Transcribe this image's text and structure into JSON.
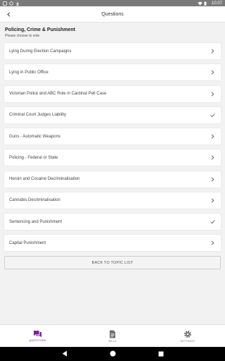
{
  "status_bar": {
    "time": "10:07"
  },
  "header": {
    "title": "Questions"
  },
  "section": {
    "title": "Policing, Crime & Punishment",
    "subtitle": "Please choose to vote"
  },
  "questions": [
    {
      "label": "Lying During Election Campaigns",
      "state": "chevron-right-icon"
    },
    {
      "label": "Lying in Public Office",
      "state": "chevron-right-icon"
    },
    {
      "label": "Victorian Police and ABC Role in Cardinal Pell Case",
      "state": "chevron-right-icon"
    },
    {
      "label": "Criminal Court Judges Liability",
      "state": "checkmark-icon"
    },
    {
      "label": "Guns - Automatic Weapons",
      "state": "chevron-right-icon"
    },
    {
      "label": "Policing - Federal or State",
      "state": "chevron-right-icon"
    },
    {
      "label": "Heroin and Cocaine Decriminalisation",
      "state": "chevron-right-icon"
    },
    {
      "label": "Cannabis Decriminalisation",
      "state": "chevron-right-icon"
    },
    {
      "label": "Sentencing and Punishment",
      "state": "checkmark-icon"
    },
    {
      "label": "Capital Punishment",
      "state": "chevron-right-icon"
    }
  ],
  "back_button": {
    "label": "BACK TO TOPIC LIST"
  },
  "bottom_nav": {
    "questions": "QUESTIONS",
    "bills": "BILLS",
    "settings": "SETTINGS"
  },
  "colors": {
    "accent": "#7b1fa2",
    "status_bar": "#7a7a7a"
  }
}
